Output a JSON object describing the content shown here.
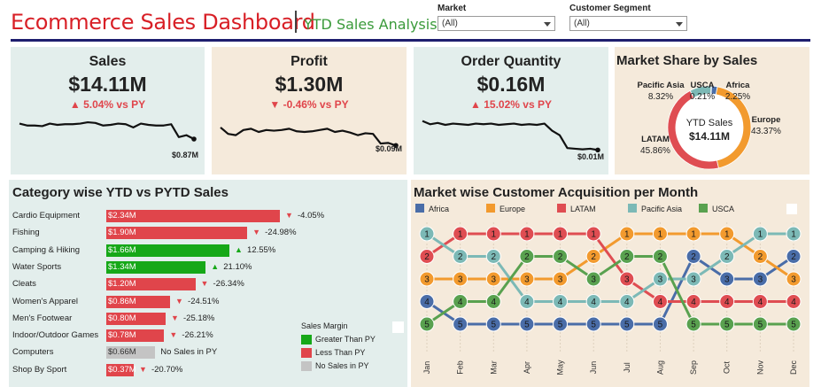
{
  "header": {
    "title": "Ecommerce Sales Dashboard",
    "subtitle": "YTD Sales Analysis"
  },
  "filters": [
    {
      "label": "Market",
      "value": "(All)"
    },
    {
      "label": "Customer Segment",
      "value": "(All)"
    }
  ],
  "colors": {
    "teal_panel": "#e3eeec",
    "beige_panel": "#f5eadb",
    "red": "#e0454b",
    "green": "#16a818",
    "gray": "#c4c4c4",
    "africa": "#4a6da8",
    "europe": "#f29a2e",
    "latam": "#df4d52",
    "pacific_asia": "#7cb9b6",
    "usca": "#59a14f"
  },
  "kpis": [
    {
      "title": "Sales",
      "value": "$14.11M",
      "delta": "▲ 5.04% vs PY",
      "spark_end": "$0.87M",
      "spark": [
        0.86,
        0.83,
        0.83,
        0.82,
        0.86,
        0.84,
        0.85,
        0.85,
        0.86,
        0.88,
        0.87,
        0.83,
        0.84,
        0.86,
        0.85,
        0.8,
        0.86,
        0.84,
        0.83,
        0.83,
        0.85,
        0.65,
        0.68,
        0.62
      ]
    },
    {
      "title": "Profit",
      "value": "$1.30M",
      "delta": "▼ -0.46% vs PY",
      "spark_end": "$0.09M",
      "spark": [
        0.8,
        0.7,
        0.68,
        0.76,
        0.78,
        0.73,
        0.76,
        0.75,
        0.76,
        0.78,
        0.74,
        0.73,
        0.74,
        0.76,
        0.78,
        0.73,
        0.75,
        0.72,
        0.68,
        0.71,
        0.7,
        0.55,
        0.56,
        0.52
      ]
    },
    {
      "title": "Order Quantity",
      "value": "$0.16M",
      "delta": "▲ 15.02% vs PY",
      "spark_end": "$0.01M",
      "spark": [
        0.9,
        0.85,
        0.87,
        0.84,
        0.86,
        0.85,
        0.84,
        0.86,
        0.85,
        0.86,
        0.84,
        0.85,
        0.86,
        0.84,
        0.85,
        0.84,
        0.86,
        0.75,
        0.68,
        0.48,
        0.47,
        0.46,
        0.47,
        0.45
      ]
    }
  ],
  "market_share": {
    "title": "Market Share by Sales",
    "center_label": "YTD Sales",
    "center_value": "$14.11M",
    "slices": [
      {
        "name": "Africa",
        "pct": "2.25%",
        "value": 2.25,
        "color": "#4a6da8"
      },
      {
        "name": "Europe",
        "pct": "43.37%",
        "value": 43.37,
        "color": "#f29a2e"
      },
      {
        "name": "LATAM",
        "pct": "45.86%",
        "value": 45.86,
        "color": "#df4d52"
      },
      {
        "name": "Pacific Asia",
        "pct": "8.32%",
        "value": 8.32,
        "color": "#7cb9b6"
      },
      {
        "name": "USCA",
        "pct": "0.21%",
        "value": 0.21,
        "color": "#59a14f"
      }
    ]
  },
  "category": {
    "title": "Category wise YTD vs PYTD Sales",
    "rows": [
      {
        "name": "Cardio Equipment",
        "label": "$2.34M",
        "value": 2.34,
        "status": "less",
        "pct": "-4.05%"
      },
      {
        "name": "Fishing",
        "label": "$1.90M",
        "value": 1.9,
        "status": "less",
        "pct": "-24.98%"
      },
      {
        "name": "Camping & Hiking",
        "label": "$1.66M",
        "value": 1.66,
        "status": "greater",
        "pct": "12.55%"
      },
      {
        "name": "Water Sports",
        "label": "$1.34M",
        "value": 1.34,
        "status": "greater",
        "pct": "21.10%"
      },
      {
        "name": "Cleats",
        "label": "$1.20M",
        "value": 1.2,
        "status": "less",
        "pct": "-26.34%"
      },
      {
        "name": "Women's Apparel",
        "label": "$0.86M",
        "value": 0.86,
        "status": "less",
        "pct": "-24.51%"
      },
      {
        "name": "Men's Footwear",
        "label": "$0.80M",
        "value": 0.8,
        "status": "less",
        "pct": "-25.18%"
      },
      {
        "name": "Indoor/Outdoor Games",
        "label": "$0.78M",
        "value": 0.78,
        "status": "less",
        "pct": "-26.21%"
      },
      {
        "name": "Computers",
        "label": "$0.66M",
        "value": 0.66,
        "status": "none",
        "pct": "No Sales in PY"
      },
      {
        "name": "Shop By Sport",
        "label": "$0.37M",
        "value": 0.37,
        "status": "less",
        "pct": "-20.70%"
      }
    ],
    "legend": {
      "title": "Sales Margin",
      "items": [
        {
          "label": "Greater Than PY",
          "color": "#16a818"
        },
        {
          "label": "Less Than PY",
          "color": "#e0454b"
        },
        {
          "label": "No Sales in PY",
          "color": "#c4c4c4"
        }
      ]
    }
  },
  "chart_data": {
    "type": "line",
    "title": "Market wise Customer Acquisition per Month",
    "x": [
      "Jan",
      "Feb",
      "Mar",
      "Apr",
      "May",
      "Jun",
      "Jul",
      "Aug",
      "Sep",
      "Oct",
      "Nov",
      "Dec"
    ],
    "ylim": [
      1,
      5
    ],
    "series": [
      {
        "name": "Africa",
        "color": "#4a6da8",
        "values": [
          4,
          5,
          5,
          5,
          5,
          5,
          5,
          5,
          2,
          3,
          3,
          2
        ]
      },
      {
        "name": "Europe",
        "color": "#f29a2e",
        "values": [
          3,
          3,
          3,
          3,
          3,
          2,
          1,
          1,
          1,
          1,
          2,
          3
        ]
      },
      {
        "name": "LATAM",
        "color": "#df4d52",
        "values": [
          2,
          1,
          1,
          1,
          1,
          1,
          3,
          4,
          4,
          4,
          4,
          4
        ]
      },
      {
        "name": "Pacific Asia",
        "color": "#7cb9b6",
        "values": [
          1,
          2,
          2,
          4,
          4,
          4,
          4,
          3,
          3,
          2,
          1,
          1
        ]
      },
      {
        "name": "USCA",
        "color": "#59a14f",
        "values": [
          5,
          4,
          4,
          2,
          2,
          3,
          2,
          2,
          5,
          5,
          5,
          5
        ]
      }
    ]
  }
}
